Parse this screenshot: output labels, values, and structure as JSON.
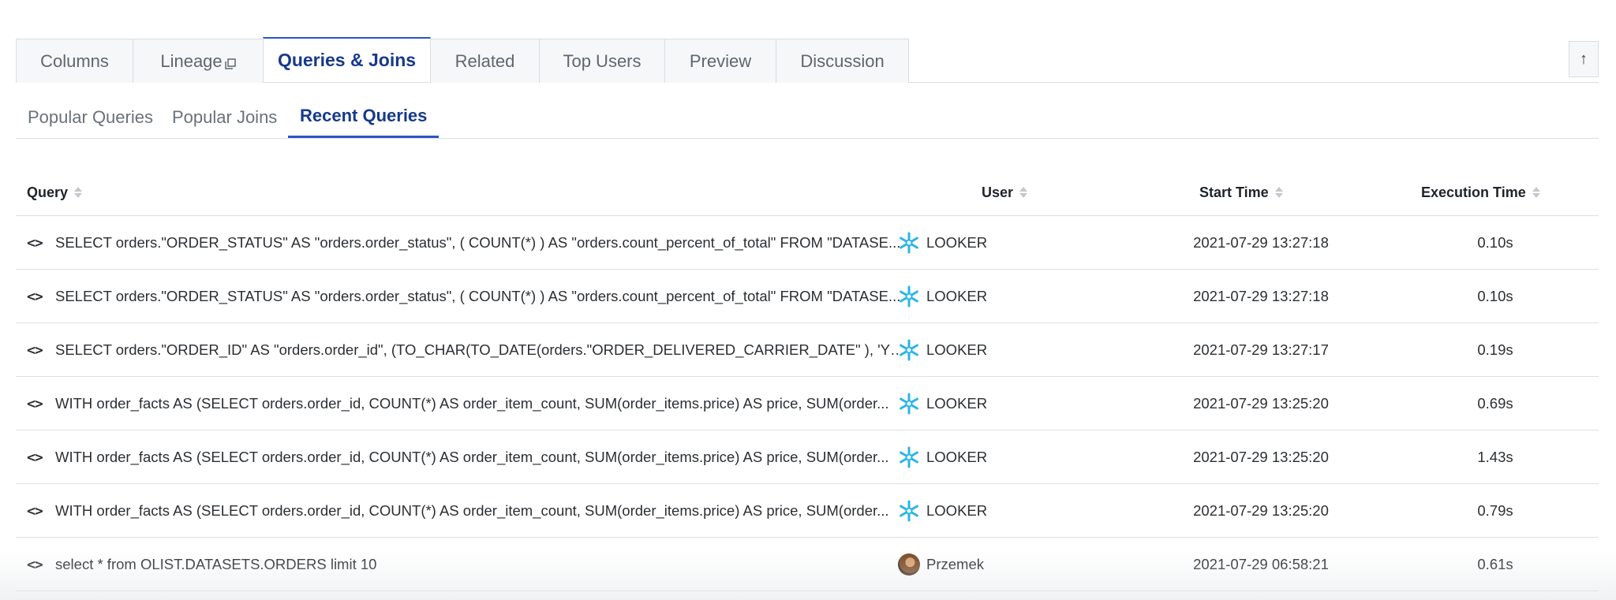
{
  "tabs": [
    {
      "label": "Columns",
      "active": false
    },
    {
      "label": "Lineage",
      "active": false
    },
    {
      "label": "Queries & Joins",
      "active": true
    },
    {
      "label": "Related",
      "active": false
    },
    {
      "label": "Top Users",
      "active": false
    },
    {
      "label": "Preview",
      "active": false
    },
    {
      "label": "Discussion",
      "active": false
    }
  ],
  "scroll_top_label": "↑",
  "subtabs": [
    {
      "label": "Popular Queries",
      "active": false
    },
    {
      "label": "Popular Joins",
      "active": false
    },
    {
      "label": "Recent Queries",
      "active": true
    }
  ],
  "table": {
    "headers": {
      "query": "Query",
      "user": "User",
      "start_time": "Start Time",
      "execution_time": "Execution Time"
    },
    "code_icon_glyph": "<>",
    "rows": [
      {
        "query": "SELECT orders.\"ORDER_STATUS\" AS \"orders.order_status\", ( COUNT(*) ) AS \"orders.count_percent_of_total\" FROM \"DATASE...",
        "user": "LOOKER",
        "user_icon": "snowflake-icon",
        "start_time": "2021-07-29 13:27:18",
        "execution_time": "0.10s"
      },
      {
        "query": "SELECT orders.\"ORDER_STATUS\" AS \"orders.order_status\", ( COUNT(*) ) AS \"orders.count_percent_of_total\" FROM \"DATASE...",
        "user": "LOOKER",
        "user_icon": "snowflake-icon",
        "start_time": "2021-07-29 13:27:18",
        "execution_time": "0.10s"
      },
      {
        "query": "SELECT orders.\"ORDER_ID\" AS \"orders.order_id\", (TO_CHAR(TO_DATE(orders.\"ORDER_DELIVERED_CARRIER_DATE\" ), 'YYYY-...",
        "user": "LOOKER",
        "user_icon": "snowflake-icon",
        "start_time": "2021-07-29 13:27:17",
        "execution_time": "0.19s"
      },
      {
        "query": "WITH order_facts AS (SELECT orders.order_id, COUNT(*) AS order_item_count, SUM(order_items.price) AS price, SUM(order...",
        "user": "LOOKER",
        "user_icon": "snowflake-icon",
        "start_time": "2021-07-29 13:25:20",
        "execution_time": "0.69s"
      },
      {
        "query": "WITH order_facts AS (SELECT orders.order_id, COUNT(*) AS order_item_count, SUM(order_items.price) AS price, SUM(order...",
        "user": "LOOKER",
        "user_icon": "snowflake-icon",
        "start_time": "2021-07-29 13:25:20",
        "execution_time": "1.43s"
      },
      {
        "query": "WITH order_facts AS (SELECT orders.order_id, COUNT(*) AS order_item_count, SUM(order_items.price) AS price, SUM(order...",
        "user": "LOOKER",
        "user_icon": "snowflake-icon",
        "start_time": "2021-07-29 13:25:20",
        "execution_time": "0.79s"
      },
      {
        "query": "select * from OLIST.DATASETS.ORDERS limit 10",
        "user": "Przemek",
        "user_icon": "user-avatar",
        "start_time": "2021-07-29 06:58:21",
        "execution_time": "0.61s"
      }
    ]
  },
  "colors": {
    "accent": "#2a55c4",
    "active_text": "#163a8a",
    "snowflake": "#29b5e8"
  }
}
